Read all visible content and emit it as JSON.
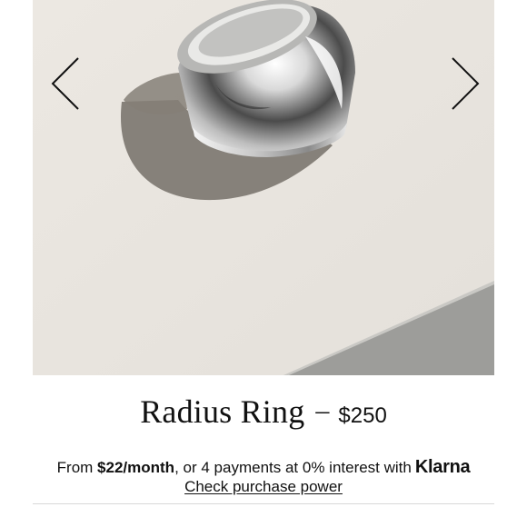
{
  "product": {
    "name": "Radius Ring",
    "separator": "–",
    "price": "$250"
  },
  "financing": {
    "prefix": "From ",
    "monthly": "$22/month",
    "middle": ", or 4 payments at 0% interest with",
    "provider": "Klarna",
    "link_label": "Check purchase power"
  },
  "gallery": {
    "prev_icon": "chevron-left-icon",
    "next_icon": "chevron-right-icon",
    "image_subject": "silver dome ring"
  },
  "colors": {
    "background": "#ffffff",
    "photo_backdrop": "#ebe7e1",
    "text": "#111111",
    "divider": "#d8d8d8"
  }
}
